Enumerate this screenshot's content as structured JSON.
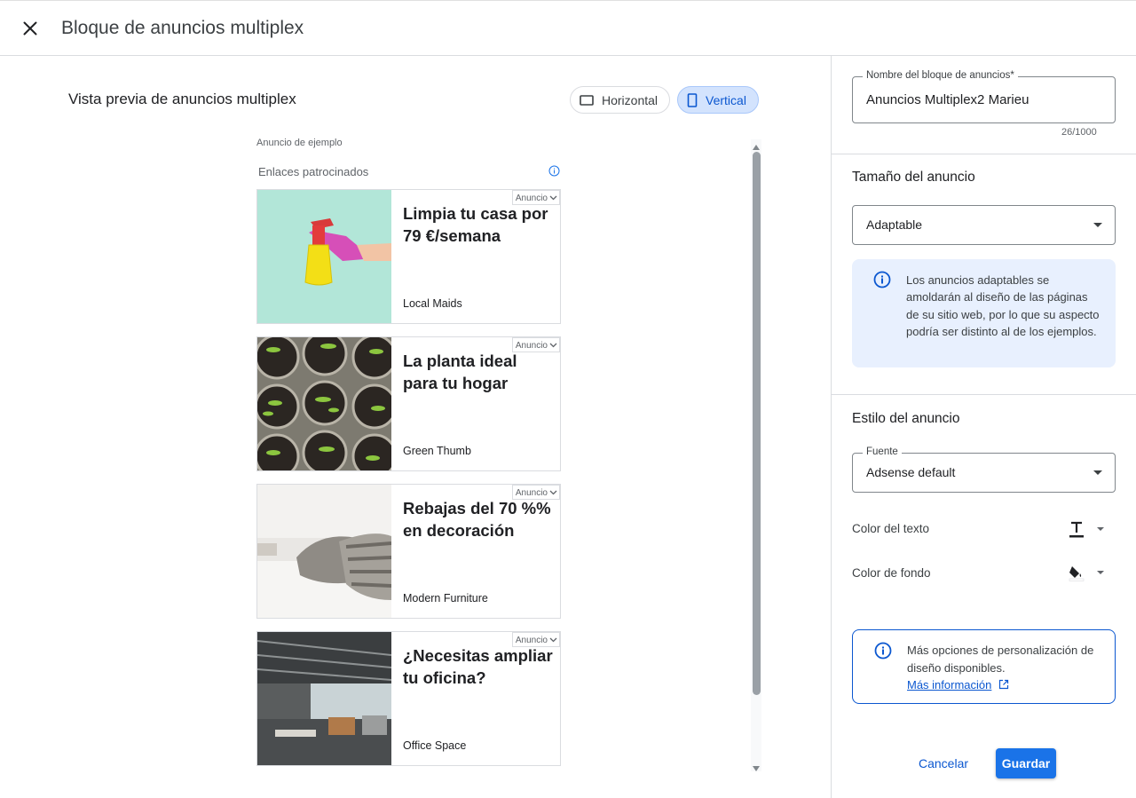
{
  "header": {
    "title": "Bloque de anuncios multiplex"
  },
  "preview": {
    "title": "Vista previa de anuncios multiplex",
    "orientation": {
      "horizontal_label": "Horizontal",
      "vertical_label": "Vertical",
      "selected": "Vertical"
    },
    "sample_label": "Anuncio de ejemplo",
    "sponsored_label": "Enlaces patrocinados",
    "ads": [
      {
        "headline": "Limpia tu casa por 79 €/semana",
        "advertiser": "Local Maids",
        "badge": "Anuncio"
      },
      {
        "headline": "La planta ideal para tu hogar",
        "advertiser": "Green Thumb",
        "badge": "Anuncio"
      },
      {
        "headline": "Rebajas del 70 %% en decoración",
        "advertiser": "Modern Furniture",
        "badge": "Anuncio"
      },
      {
        "headline": "¿Necesitas ampliar tu oficina?",
        "advertiser": "Office Space",
        "badge": "Anuncio"
      }
    ]
  },
  "settings": {
    "name_field": {
      "label": "Nombre del bloque de anuncios*",
      "value": "Anuncios Multiplex2 Marieu",
      "counter": "26/1000"
    },
    "size_section": {
      "title": "Tamaño del anuncio",
      "selected": "Adaptable",
      "info": "Los anuncios adaptables se amoldarán al diseño de las páginas de su sitio web, por lo que su aspecto podría ser distinto al de los ejemplos."
    },
    "style_section": {
      "title": "Estilo del anuncio",
      "font_label": "Fuente",
      "font_value": "Adsense default",
      "text_color_label": "Color del texto",
      "bg_color_label": "Color de fondo"
    },
    "more_options": {
      "text": "Más opciones de personalización de diseño disponibles.",
      "link": "Más información"
    },
    "cancel_label": "Cancelar",
    "save_label": "Guardar"
  },
  "colors": {
    "accent": "#0b57d0",
    "save_button": "#1a73e8",
    "info_bg": "#e8f0fe"
  }
}
